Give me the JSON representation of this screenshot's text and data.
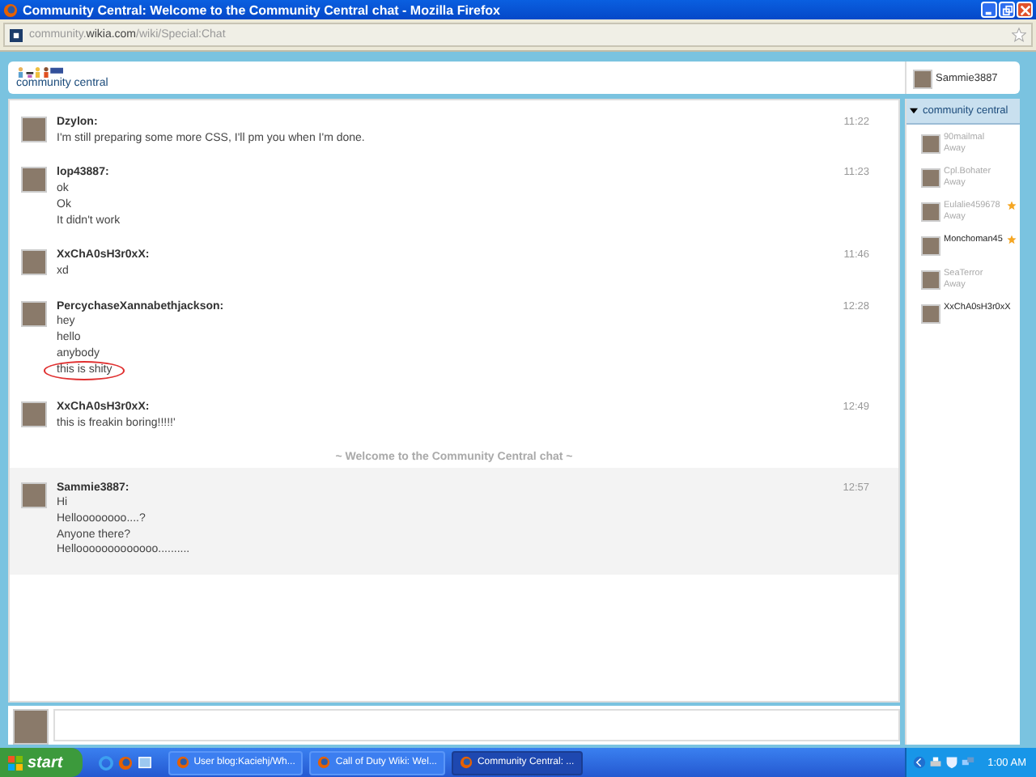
{
  "window": {
    "title": "Community Central: Welcome to the Community Central chat - Mozilla Firefox"
  },
  "address_bar": {
    "url": "community.**wikia.com**/wiki/Special:Chat"
  },
  "header": {
    "logo_text": "community central",
    "user": "Sammie3887"
  },
  "messages": [
    {
      "kind": "message",
      "author": "Dzylon:",
      "time": "11:22",
      "own": false,
      "lines": [
        {
          "text": "I'm still preparing some more CSS, I'll pm you when I'm done.",
          "circled": false
        }
      ]
    },
    {
      "kind": "message",
      "author": "lop43887:",
      "time": "11:23",
      "own": false,
      "lines": [
        {
          "text": "ok",
          "circled": false
        },
        {
          "text": "Ok",
          "circled": false
        },
        {
          "text": "It didn't work",
          "circled": false
        }
      ]
    },
    {
      "kind": "message",
      "author": "XxChA0sH3r0xX:",
      "time": "11:46",
      "own": false,
      "lines": [
        {
          "text": "xd",
          "circled": false
        }
      ]
    },
    {
      "kind": "message",
      "author": "PercychaseXannabethjackson:",
      "time": "12:28",
      "own": false,
      "lines": [
        {
          "text": "hey",
          "circled": false
        },
        {
          "text": "hello",
          "circled": false
        },
        {
          "text": "anybody",
          "circled": false
        },
        {
          "text": "this is shity",
          "circled": true
        }
      ]
    },
    {
      "kind": "message",
      "author": "XxChA0sH3r0xX:",
      "time": "12:49",
      "own": false,
      "lines": [
        {
          "text": "this is freakin boring!!!!!'",
          "circled": false
        }
      ]
    },
    {
      "kind": "notice",
      "text": "~ Welcome to the Community Central chat ~"
    },
    {
      "kind": "message",
      "author": "Sammie3887:",
      "time": "12:57",
      "own": true,
      "lines": [
        {
          "text": "Hi",
          "circled": false
        },
        {
          "text": "Helloooooooo....?",
          "circled": false
        },
        {
          "text": "Anyone there?",
          "circled": false
        },
        {
          "text": "Hellooooooooooooo..........",
          "circled": false
        }
      ]
    }
  ],
  "sidebar": {
    "room": "community central",
    "expanded": true,
    "users": [
      {
        "name": "90mailmal",
        "status": "Away",
        "away": true,
        "starred": false
      },
      {
        "name": "Cpl.Bohater",
        "status": "Away",
        "away": true,
        "starred": false
      },
      {
        "name": "Eulalie459678",
        "status": "Away",
        "away": true,
        "starred": true
      },
      {
        "name": "Monchoman45",
        "away": false,
        "starred": true
      },
      {
        "name": "SeaTerror",
        "status": "Away",
        "away": true,
        "starred": false
      },
      {
        "name": "XxChA0sH3r0xX",
        "away": false,
        "starred": false
      }
    ]
  },
  "taskbar": {
    "start": "start",
    "tasks": [
      {
        "label": "User blog:Kaciehj/Wh...",
        "selected": false
      },
      {
        "label": "Call of Duty Wiki: Wel...",
        "selected": false
      },
      {
        "label": "Community Central: ...",
        "selected": true
      }
    ],
    "clock": "1:00 AM"
  }
}
